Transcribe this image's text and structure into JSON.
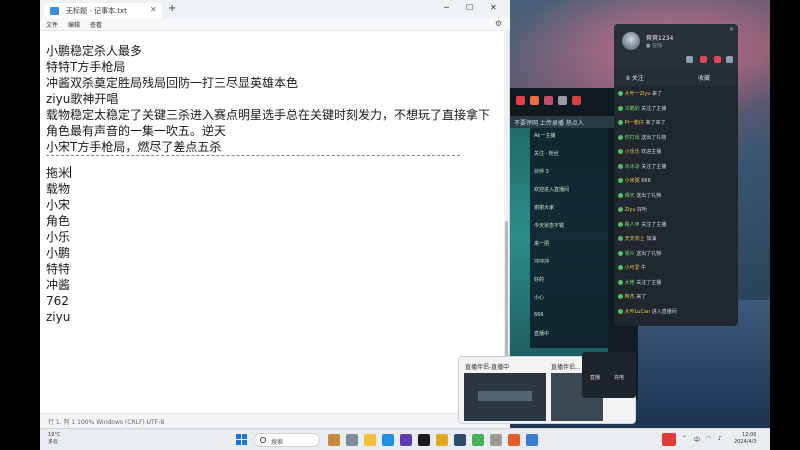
{
  "notepad": {
    "tab_title": "无标题 - 记事本.txt",
    "menu": [
      "文件",
      "编辑",
      "查看"
    ],
    "lines_top": [
      "小鹏稳定杀人最多",
      "特特T方手枪局",
      "冲酱双杀奠定胜局残局回防一打三尽显英雄本色",
      "ziyu歌神开唱",
      "载物稳定太稳定了关键三杀进入赛点明星选手总在关键时刻发力，不想玩了直接拿下",
      "角色最有声音的一集一吹五。逆天",
      "小宋T方手枪局，燃尽了差点五杀"
    ],
    "lines_bottom": [
      "拖米",
      "载物",
      "小宋",
      "角色",
      "小乐",
      "小鹏",
      "特特",
      "冲酱",
      "762",
      "ziyu"
    ],
    "status": "行 1, 列 1    100%    Windows (CRLF)    UTF-8"
  },
  "chat": {
    "user_name": "爽爽1234",
    "user_sub": "● 在线",
    "tab_left": "8 关注",
    "tab_right": "收藏",
    "messages": [
      {
        "user": "大叶一Ziyu",
        "text": "来了",
        "color": "u"
      },
      {
        "user": "冷酷的",
        "text": "关注了主播",
        "color": "g"
      },
      {
        "user": "Pi一鹏仔",
        "text": "来了来了",
        "color": "u"
      },
      {
        "user": "你打出",
        "text": "送出了礼物",
        "color": "g"
      },
      {
        "user": "小乐乐",
        "text": "欢迎主播",
        "color": "u"
      },
      {
        "user": "冰冰凉",
        "text": "关注了主播",
        "color": "g"
      },
      {
        "user": "小米粥",
        "text": "666",
        "color": "u"
      },
      {
        "user": "晴天",
        "text": "送出了礼物",
        "color": "g"
      },
      {
        "user": "Ziyu",
        "text": "好听",
        "color": "u"
      },
      {
        "user": "路人甲",
        "text": "关注了主播",
        "color": "g"
      },
      {
        "user": "天天向上",
        "text": "加油",
        "color": "u"
      },
      {
        "user": "观众",
        "text": "送出了礼物",
        "color": "g"
      },
      {
        "user": "小可爱",
        "text": "牛",
        "color": "u"
      },
      {
        "user": "大佬",
        "text": "关注了主播",
        "color": "g"
      },
      {
        "user": "阿杰",
        "text": "来了",
        "color": "u"
      },
      {
        "user": "大叶LuCan",
        "text": "进入直播间",
        "color": "u"
      }
    ]
  },
  "stream": {
    "tabs": "不要停网    上传录播    热点人",
    "side_buttons": [
      "工具",
      "分屏",
      "录屏"
    ],
    "panel_lines": [
      "Ak一主播",
      "关注 · 粉丝",
      "伙伴 3",
      "欢迎进入直播间",
      "谢谢大家",
      "今天状态不错",
      "来一把",
      "冲冲冲",
      "好的",
      "小心",
      "666",
      "直播中"
    ]
  },
  "preview": {
    "title1": "直播伴侣-直播中",
    "title2": "直播伴侣...",
    "btn1": "直播",
    "btn2": "充电"
  },
  "taskbar": {
    "weather_temp": "19°C",
    "weather_text": "多云",
    "search": "搜索",
    "clock_time": "12:00",
    "clock_date": "2024/4/3",
    "tray_lang": "中"
  },
  "colors": {
    "notepad_bg": "#ffffff",
    "chat_bg": "#20262e",
    "taskbar_bg": "#e9edf2",
    "accent": "#1a73d9"
  }
}
